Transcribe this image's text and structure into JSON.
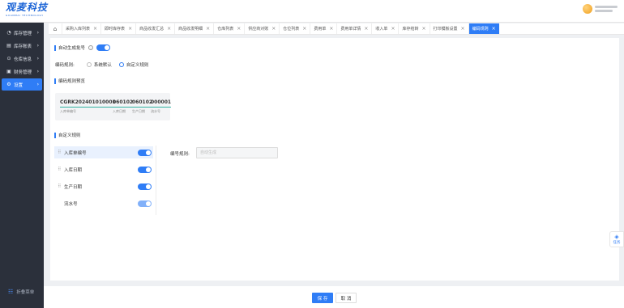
{
  "brand": {
    "name": "观麦科技",
    "subtitle": "GUANMAI TECHNOLOGY"
  },
  "sidebar": {
    "items": [
      {
        "icon": "◔",
        "label": "库存管理"
      },
      {
        "icon": "▤",
        "label": "库存账表"
      },
      {
        "icon": "⊙",
        "label": "仓库信息"
      },
      {
        "icon": "▣",
        "label": "财务管理"
      },
      {
        "icon": "⚙",
        "label": "设置"
      }
    ],
    "collapse_label": "折叠菜单",
    "collapse_icon": "☷"
  },
  "tabs": {
    "home_icon": "⌂",
    "close_icon": "×",
    "items": [
      "采购入库列表",
      "即时库存表",
      "商品收发汇总",
      "商品收发明细",
      "仓库列表",
      "供应商对账",
      "仓位列表",
      "费用单",
      "费用单详情",
      "收入单",
      "库存结转",
      "打印模板设置",
      "编码规则"
    ]
  },
  "auto_generate": {
    "label": "自动生成批号",
    "enabled": true
  },
  "encoding_rule": {
    "label": "编码规则:",
    "options": [
      "系统默认",
      "自定义规则"
    ],
    "selected": "自定义规则"
  },
  "preview": {
    "title": "编码规则预览",
    "segments": [
      {
        "value": "CGRK202401010001",
        "caption": "入库单编号"
      },
      {
        "value": "060102",
        "caption": "入库日期"
      },
      {
        "value": "060102",
        "caption": "生产日期"
      },
      {
        "value": "000001",
        "caption": "流水号"
      }
    ]
  },
  "custom_rules": {
    "title": "自定义规则",
    "items": [
      {
        "label": "入库单编号",
        "enabled": true,
        "selected": true
      },
      {
        "label": "入库日期",
        "enabled": true,
        "selected": false
      },
      {
        "label": "生产日期",
        "enabled": true,
        "selected": false
      },
      {
        "label": "流水号",
        "enabled": true,
        "selected": false
      }
    ],
    "field_label": "编号规则:",
    "field_placeholder": "自动生成"
  },
  "float_task": {
    "icon": "◈",
    "label": "任务"
  },
  "footer": {
    "save": "保 存",
    "cancel": "取 消"
  },
  "colors": {
    "accent": "#2f7df6",
    "sidebar_bg": "#2b303b",
    "underline": "#2fb0a0"
  }
}
